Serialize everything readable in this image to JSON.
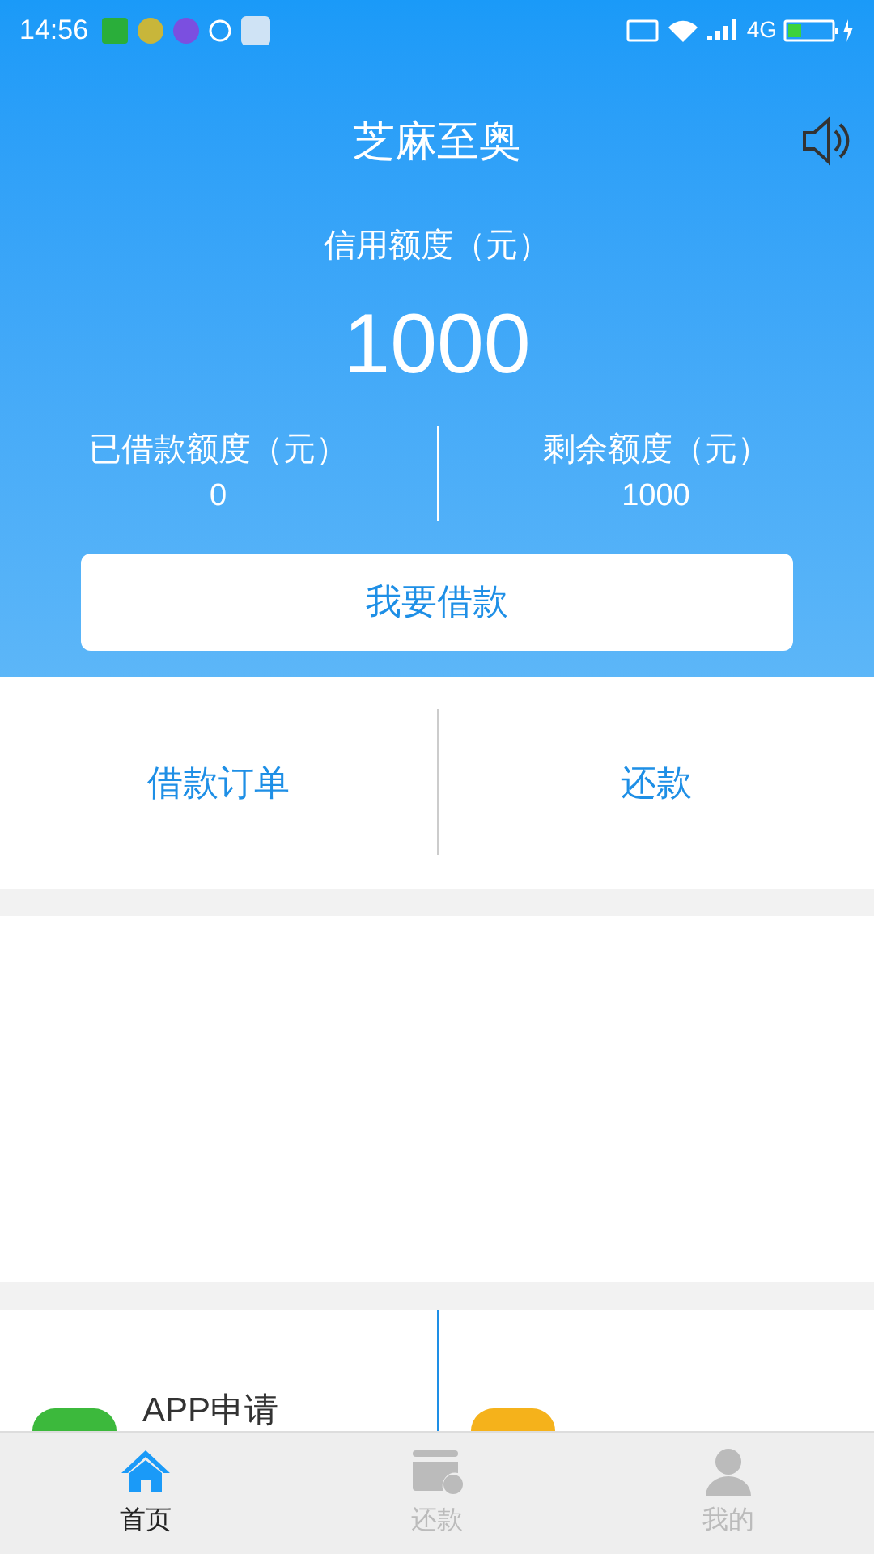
{
  "status_bar": {
    "time": "14:56",
    "network": "4G"
  },
  "header": {
    "title": "芝麻至奥",
    "credit_label": "信用额度（元）",
    "credit_amount": "1000",
    "stats": [
      {
        "label": "已借款额度（元）",
        "value": "0"
      },
      {
        "label": "剩余额度（元）",
        "value": "1000"
      }
    ],
    "borrow_button": "我要借款"
  },
  "actions": [
    "借款订单",
    "还款"
  ],
  "services": [
    {
      "label": "APP申请",
      "color": "#3cb93c"
    },
    {
      "color": "#f5b21b"
    }
  ],
  "tabs": [
    {
      "label": "首页",
      "kind": "home",
      "selected": true
    },
    {
      "label": "还款",
      "kind": "card",
      "selected": false
    },
    {
      "label": "我的",
      "kind": "user",
      "selected": false
    }
  ]
}
